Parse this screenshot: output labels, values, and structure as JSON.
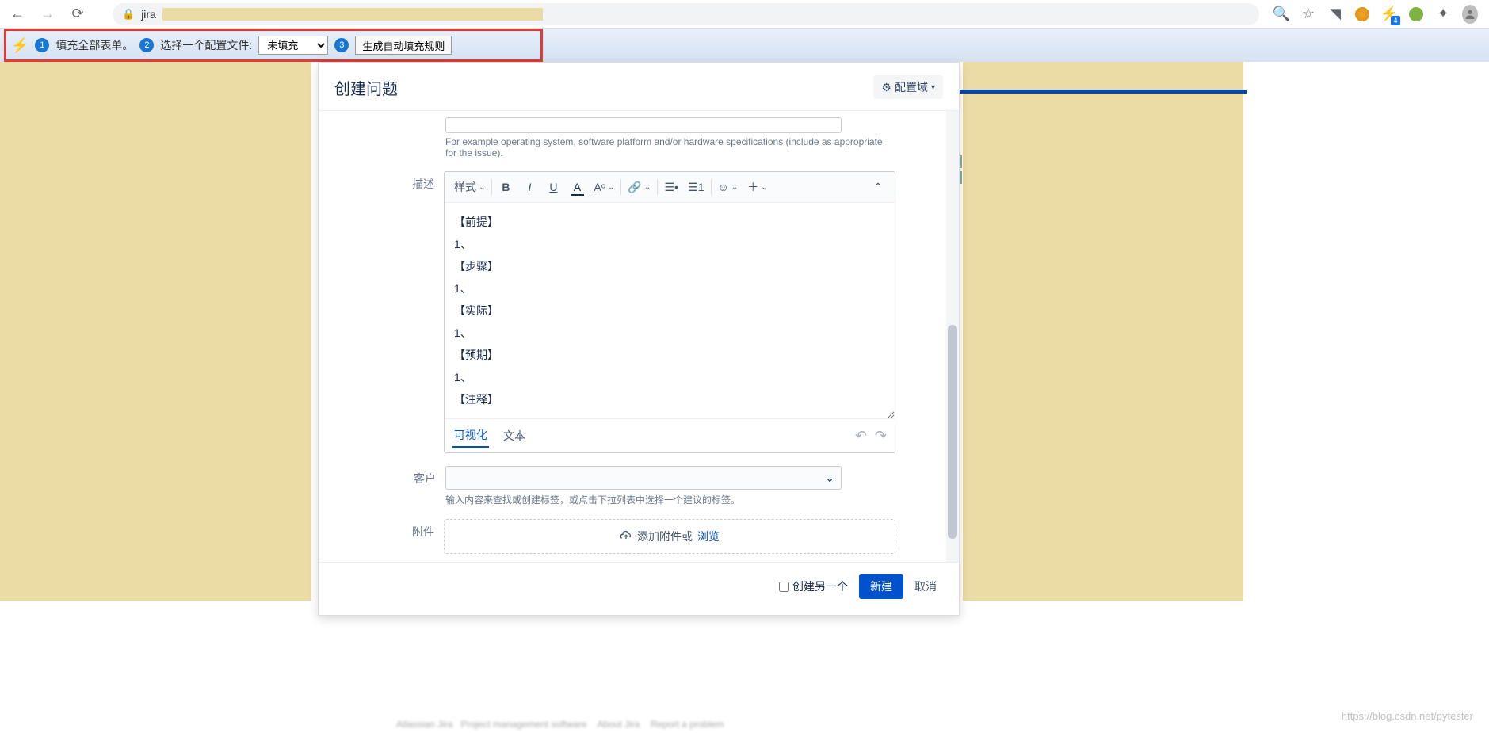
{
  "browser": {
    "url_prefix": "jira",
    "badge": "4"
  },
  "ext_bar": {
    "step1": "填充全部表单。",
    "step2": "选择一个配置文件:",
    "select_value": "未填充",
    "step3_btn": "生成自动填充规则"
  },
  "modal": {
    "title": "创建问题",
    "config_btn": "配置域",
    "env_help": "For example operating system, software platform and/or hardware specifications (include as appropriate for the issue).",
    "desc_label": "描述",
    "style_label": "样式",
    "desc_lines": [
      "【前提】",
      "1、",
      "【步骤】",
      "1、",
      "【实际】",
      "1、",
      "【预期】",
      "1、",
      "【注释】"
    ],
    "tab_visual": "可视化",
    "tab_text": "文本",
    "customer_label": "客户",
    "customer_help": "输入内容来查找或创建标签，或点击下拉列表中选择一个建议的标签。",
    "attach_label": "附件",
    "attach_text": "添加附件或 ",
    "attach_link": "浏览",
    "create_another": "创建另一个",
    "btn_create": "新建",
    "btn_cancel": "取消"
  },
  "watermark": "https://blog.csdn.net/pytester"
}
